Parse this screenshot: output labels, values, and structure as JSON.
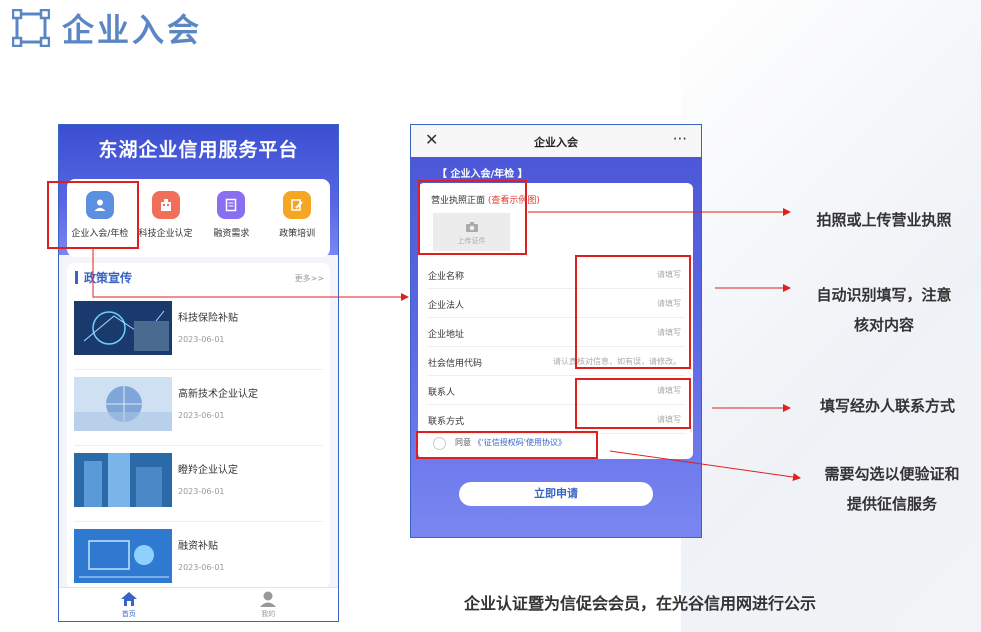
{
  "header": {
    "title": "企业入会"
  },
  "phone1": {
    "title": "东湖企业信用服务平台",
    "menu": [
      {
        "label": "企业入会/年检",
        "color": "#5b8fe0"
      },
      {
        "label": "科技企业认定",
        "color": "#ef6f5a"
      },
      {
        "label": "融资需求",
        "color": "#8a6ef0"
      },
      {
        "label": "政策培训",
        "color": "#f5a623"
      }
    ],
    "news": {
      "title": "政策宣传",
      "more": "更多>>",
      "items": [
        {
          "name": "科技保险补贴",
          "date": "2023-06-01"
        },
        {
          "name": "高新技术企业认定",
          "date": "2023-06-01"
        },
        {
          "name": "瞪羚企业认定",
          "date": "2023-06-01"
        },
        {
          "name": "融资补贴",
          "date": "2023-06-01"
        }
      ]
    },
    "tabs": [
      {
        "label": "首页"
      },
      {
        "label": "我的"
      }
    ]
  },
  "phone2": {
    "nav_title": "企业入会",
    "close": "✕",
    "more": "···",
    "section": "【 企业入会/年检 】",
    "license_label": "营业执照正面",
    "license_link": "(查看示例图)",
    "upload_label": "上传证件",
    "fields": [
      {
        "label": "企业名称",
        "placeholder": "请填写"
      },
      {
        "label": "企业法人",
        "placeholder": "请填写"
      },
      {
        "label": "企业地址",
        "placeholder": "请填写"
      },
      {
        "label": "社会信用代码",
        "placeholder": "请认真核对信息，如有误，请修改。"
      },
      {
        "label": "联系人",
        "placeholder": "请填写"
      },
      {
        "label": "联系方式",
        "placeholder": "请填写"
      }
    ],
    "agree_prefix": "同意",
    "agree_link": "《'征信授权码'使用协议》",
    "submit": "立即申请"
  },
  "annotations": {
    "license": "拍照或上传营业执照",
    "autofill_line1": "自动识别填写，注意",
    "autofill_line2": "核对内容",
    "contact": "填写经办人联系方式",
    "agree_line1": "需要勾选以便验证和",
    "agree_line2": "提供征信服务"
  },
  "footer": "企业认证暨为信促会会员，在光谷信用网进行公示",
  "colors": {
    "accent": "#3a64c4",
    "highlight": "#e01f1f",
    "title_blue": "#5b86c4"
  }
}
